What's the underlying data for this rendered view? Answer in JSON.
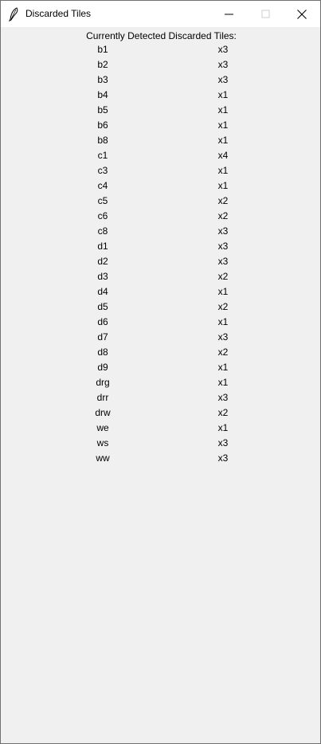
{
  "window": {
    "title": "Discarded Tiles"
  },
  "icons": {
    "app": "feather-icon",
    "minimize": "minimize-icon",
    "maximize": "maximize-icon",
    "close": "close-icon"
  },
  "header": {
    "label": "Currently Detected Discarded Tiles:"
  },
  "tiles": [
    {
      "name": "b1",
      "count": "x3"
    },
    {
      "name": "b2",
      "count": "x3"
    },
    {
      "name": "b3",
      "count": "x3"
    },
    {
      "name": "b4",
      "count": "x1"
    },
    {
      "name": "b5",
      "count": "x1"
    },
    {
      "name": "b6",
      "count": "x1"
    },
    {
      "name": "b8",
      "count": "x1"
    },
    {
      "name": "c1",
      "count": "x4"
    },
    {
      "name": "c3",
      "count": "x1"
    },
    {
      "name": "c4",
      "count": "x1"
    },
    {
      "name": "c5",
      "count": "x2"
    },
    {
      "name": "c6",
      "count": "x2"
    },
    {
      "name": "c8",
      "count": "x3"
    },
    {
      "name": "d1",
      "count": "x3"
    },
    {
      "name": "d2",
      "count": "x3"
    },
    {
      "name": "d3",
      "count": "x2"
    },
    {
      "name": "d4",
      "count": "x1"
    },
    {
      "name": "d5",
      "count": "x2"
    },
    {
      "name": "d6",
      "count": "x1"
    },
    {
      "name": "d7",
      "count": "x3"
    },
    {
      "name": "d8",
      "count": "x2"
    },
    {
      "name": "d9",
      "count": "x1"
    },
    {
      "name": "drg",
      "count": "x1"
    },
    {
      "name": "drr",
      "count": "x3"
    },
    {
      "name": "drw",
      "count": "x2"
    },
    {
      "name": "we",
      "count": "x1"
    },
    {
      "name": "ws",
      "count": "x3"
    },
    {
      "name": "ww",
      "count": "x3"
    }
  ]
}
